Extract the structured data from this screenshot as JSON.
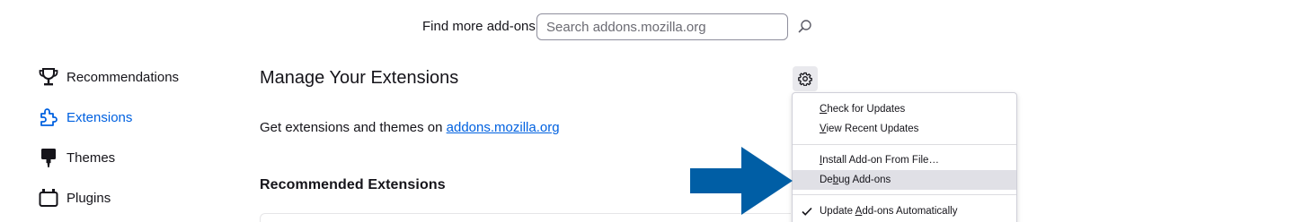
{
  "search": {
    "label": "Find more add-ons",
    "placeholder": "Search addons.mozilla.org",
    "value": ""
  },
  "sidebar": {
    "items": [
      {
        "label": "Recommendations",
        "icon": "trophy-icon",
        "active": false
      },
      {
        "label": "Extensions",
        "icon": "puzzle-icon",
        "active": true
      },
      {
        "label": "Themes",
        "icon": "brush-icon",
        "active": false
      },
      {
        "label": "Plugins",
        "icon": "plugin-icon",
        "active": false
      }
    ]
  },
  "main": {
    "title": "Manage Your Extensions",
    "subtitle_prefix": "Get extensions and themes on",
    "subtitle_link": "addons.mozilla.org",
    "section_title": "Recommended Extensions"
  },
  "menu": {
    "items": [
      {
        "label": "Check for Updates",
        "accesskey": "C"
      },
      {
        "label": "View Recent Updates",
        "accesskey": "V"
      },
      {
        "label": "Install Add-on From File…",
        "accesskey": "I"
      },
      {
        "label": "Debug Add-ons",
        "accesskey": "b",
        "highlighted": true
      },
      {
        "label": "Update Add-ons Automatically",
        "accesskey": "A",
        "checked": true
      }
    ]
  },
  "colors": {
    "accent": "#0061e0",
    "arrow": "#005ea5",
    "menu_highlight": "#e0e0e6"
  }
}
